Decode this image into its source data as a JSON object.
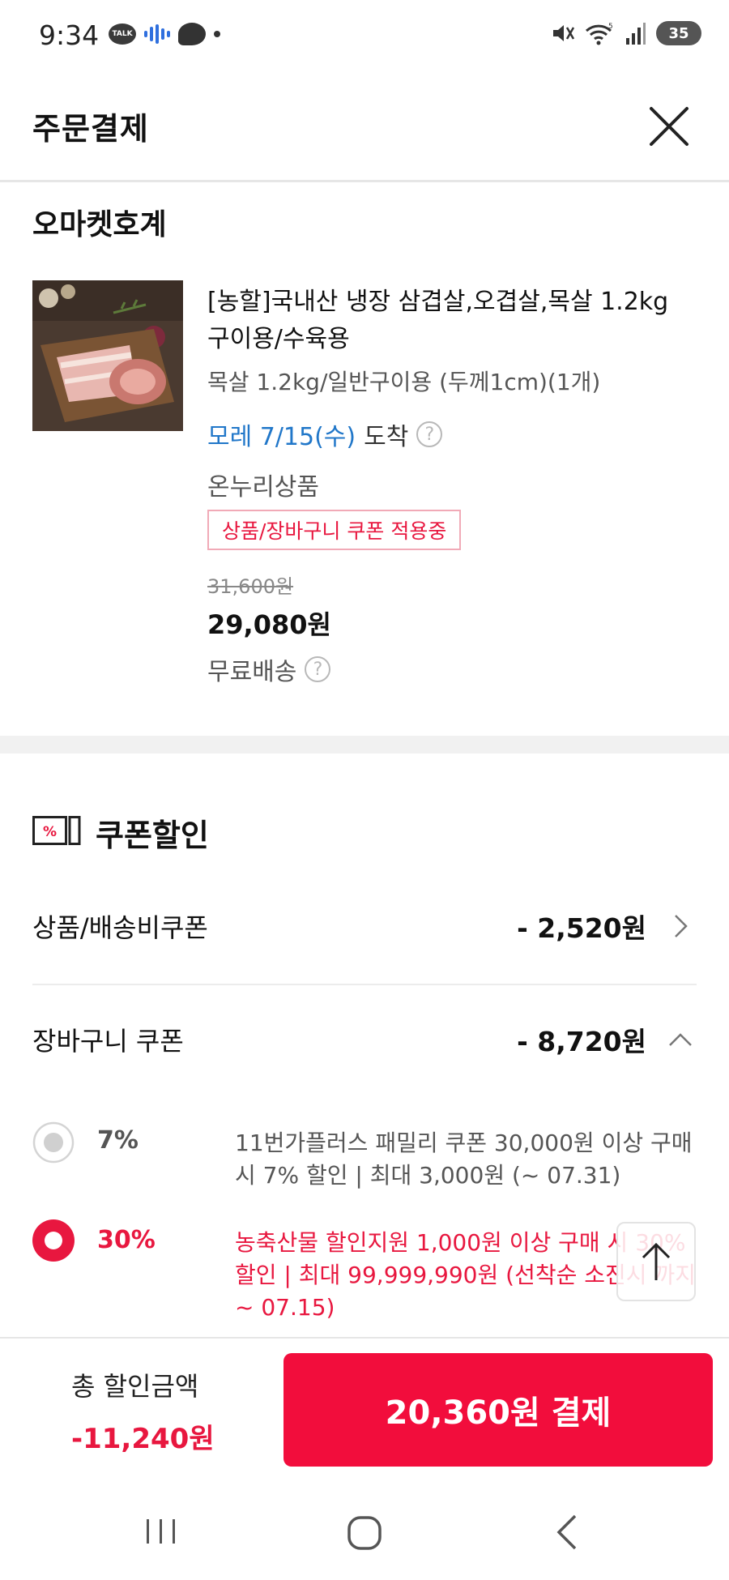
{
  "status_bar": {
    "time": "9:34",
    "talk": "TALK",
    "battery": "35"
  },
  "header": {
    "title": "주문결제"
  },
  "seller": {
    "name": "오마켓호계"
  },
  "product": {
    "title": "[농할]국내산 냉장 삼겹살,오겹살,목살 1.2kg 구이용/수육용",
    "option": "목살 1.2kg/일반구이용 (두께1cm)(1개)",
    "delivery_date": "모레 7/15(수)",
    "delivery_label": "도착",
    "onnuri": "온누리상품",
    "coupon_tag": "상품/장바구니 쿠폰 적용중",
    "original_price": "31,600원",
    "sale_price": "29,080원",
    "shipping": "무료배송"
  },
  "coupon_section": {
    "title": "쿠폰할인",
    "icon_text": "%",
    "product_coupon": {
      "label": "상품/배송비쿠폰",
      "amount": "- 2,520원"
    },
    "cart_coupon": {
      "label": "장바구니 쿠폰",
      "amount": "- 8,720원"
    },
    "options": [
      {
        "pct": "7%",
        "desc": "11번가플러스 패밀리 쿠폰 30,000원 이상 구매 시 7% 할인 | 최대 3,000원 (~ 07.31)",
        "selected": false
      },
      {
        "pct": "30%",
        "desc": "농축산물 할인지원 1,000원 이상 구매 시 30% 할인 | 최대 99,999,990원 (선착순 소진시 까지 ~ 07.15)",
        "selected": true
      }
    ]
  },
  "bottom_bar": {
    "total_label": "총 할인금액",
    "total_amount": "-11,240원",
    "pay_button": "20,360원 결제"
  },
  "colors": {
    "accent": "#f20d3c",
    "discount": "#e8173f",
    "delivery": "#2177c9"
  },
  "icons": [
    "close-icon",
    "help-icon",
    "coupon-icon",
    "chevron-right-icon",
    "chevron-up-icon",
    "arrow-up-icon",
    "nav-recent-icon",
    "nav-home-icon",
    "nav-back-icon"
  ]
}
